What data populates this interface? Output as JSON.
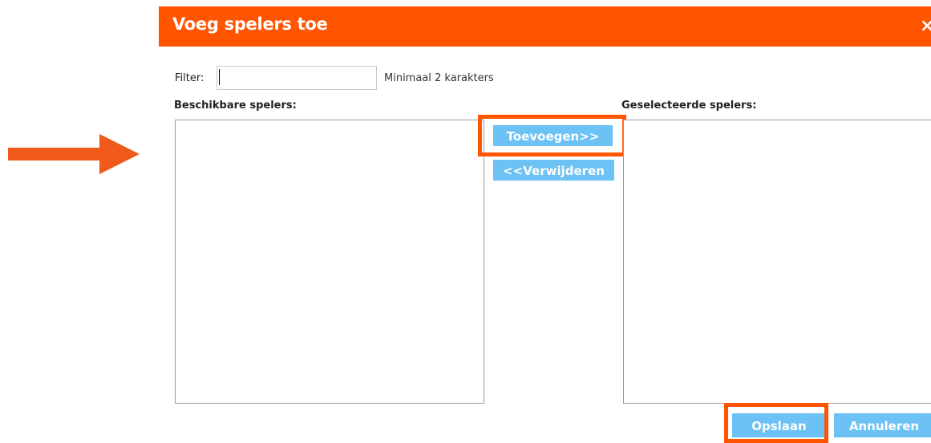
{
  "dialog": {
    "title": "Voeg spelers toe",
    "close_label": "×",
    "accent_color": "#ff5400",
    "button_color": "#6cc1f5"
  },
  "filter": {
    "label": "Filter:",
    "value": "",
    "hint": "Minimaal 2 karakters"
  },
  "available": {
    "label": "Beschikbare spelers:",
    "items": []
  },
  "selected": {
    "label": "Geselecteerde spelers:",
    "items": []
  },
  "buttons": {
    "add": "Toevoegen>>",
    "remove": "<<Verwijderen",
    "save": "Opslaan",
    "cancel": "Annuleren"
  },
  "annotations": {
    "arrow_icon": "right-arrow-icon",
    "highlight_color": "#ff5400"
  }
}
